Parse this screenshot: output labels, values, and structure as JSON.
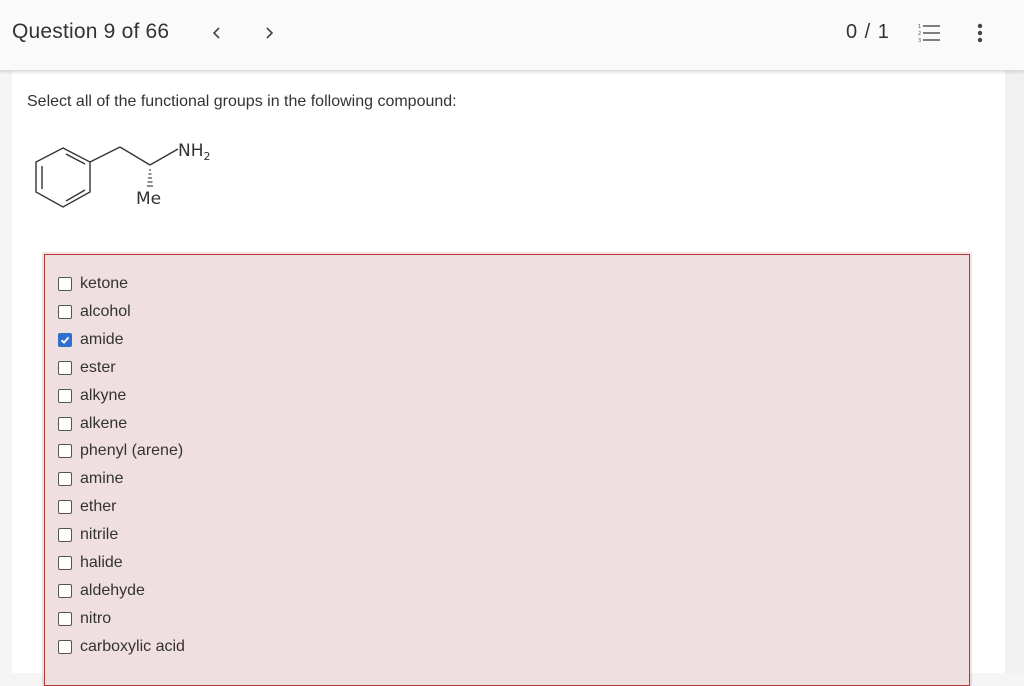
{
  "header": {
    "question_title": "Question 9 of 66",
    "prev_icon": "chevron-left-icon",
    "next_icon": "chevron-right-icon",
    "score": "0 / 1",
    "list_icon": "numbered-list-icon",
    "menu_icon": "more-vertical-icon"
  },
  "question": {
    "prompt": "Select all of the functional groups in the following compound:",
    "molecule_labels": {
      "nh2": "NH",
      "nh2_subscript": "2",
      "me": "Me"
    }
  },
  "options": [
    {
      "label": "ketone",
      "checked": false
    },
    {
      "label": "alcohol",
      "checked": false
    },
    {
      "label": "amide",
      "checked": true
    },
    {
      "label": "ester",
      "checked": false
    },
    {
      "label": "alkyne",
      "checked": false
    },
    {
      "label": "alkene",
      "checked": false
    },
    {
      "label": "phenyl (arene)",
      "checked": false
    },
    {
      "label": "amine",
      "checked": false
    },
    {
      "label": "ether",
      "checked": false
    },
    {
      "label": "nitrile",
      "checked": false
    },
    {
      "label": "halide",
      "checked": false
    },
    {
      "label": "aldehyde",
      "checked": false
    },
    {
      "label": "nitro",
      "checked": false
    },
    {
      "label": "carboxylic acid",
      "checked": false
    }
  ],
  "colors": {
    "answer_box_bg": "#efdfe0",
    "answer_box_border": "#b03a3a",
    "checkbox_checked": "#2f6fce"
  }
}
